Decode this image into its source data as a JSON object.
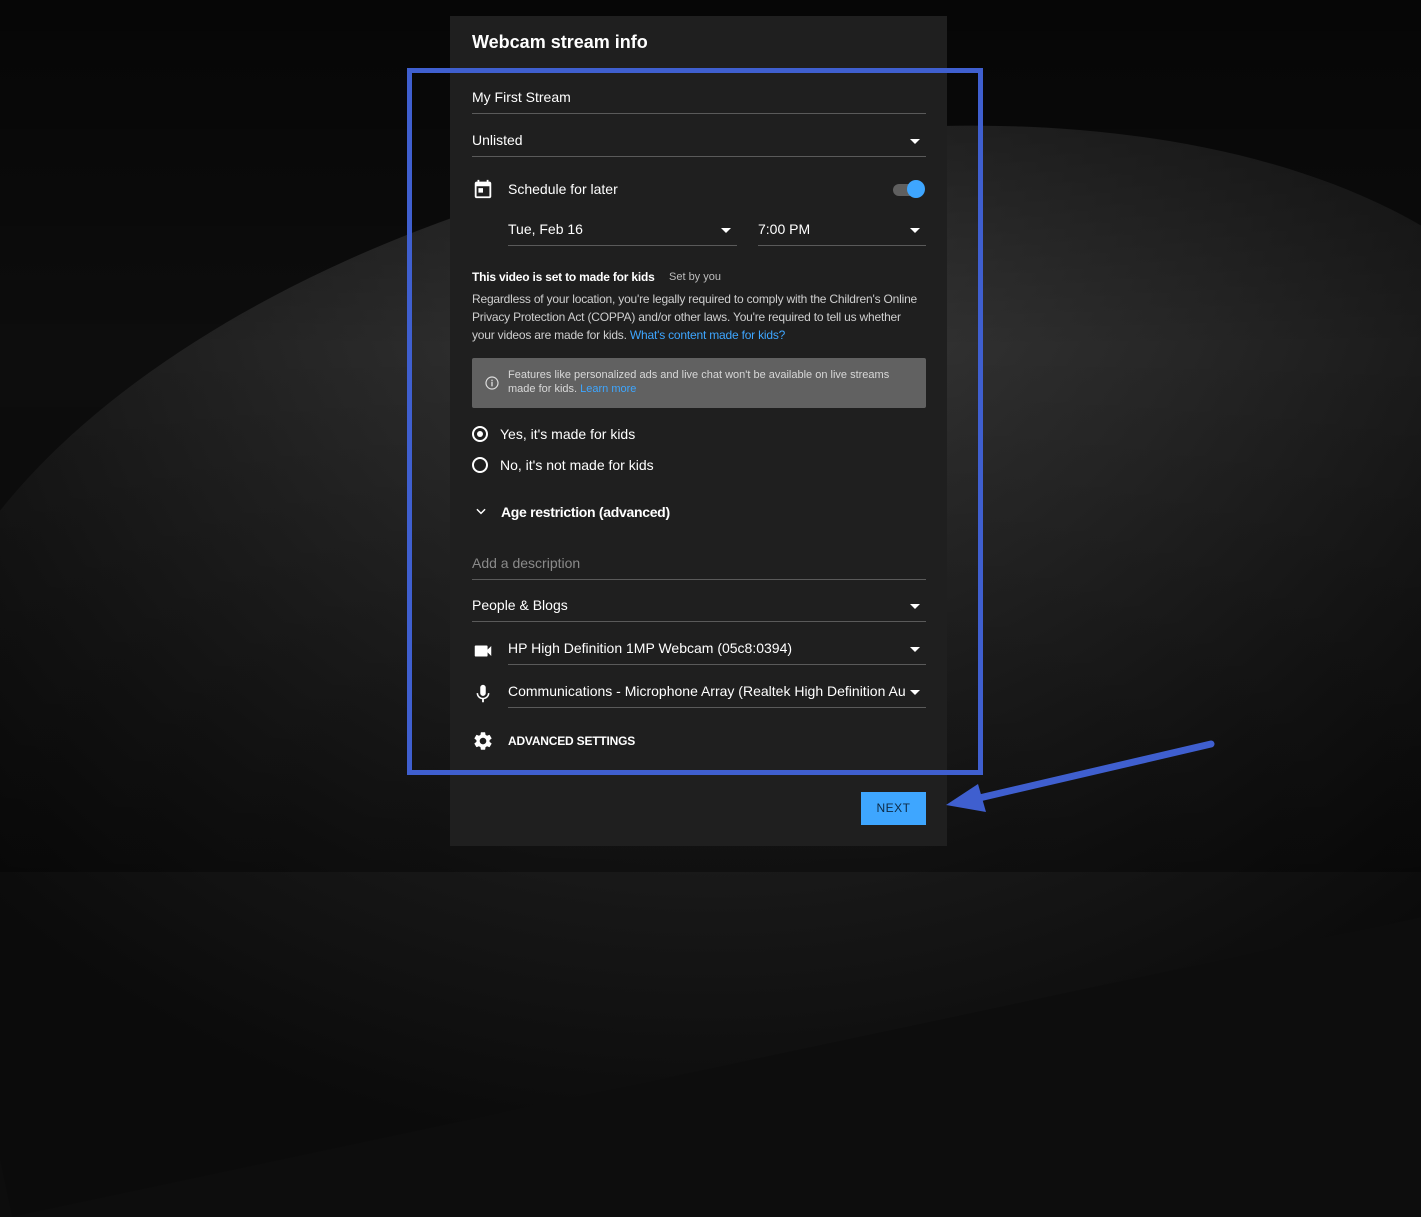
{
  "dialog": {
    "title": "Webcam stream info",
    "stream_title": "My First Stream",
    "visibility": "Unlisted",
    "schedule_label": "Schedule for later",
    "schedule_enabled": true,
    "date": "Tue, Feb 16",
    "time": "7:00 PM",
    "kids": {
      "heading": "This video is set to made for kids",
      "set_by": "Set by you",
      "body": "Regardless of your location, you're legally required to comply with the Children's Online Privacy Protection Act (COPPA) and/or other laws. You're required to tell us whether your videos are made for kids.",
      "body_link": "What's content made for kids?",
      "info_text": "Features like personalized ads and live chat won't be available on live streams made for kids.",
      "info_link": "Learn more",
      "option_yes": "Yes, it's made for kids",
      "option_no": "No, it's not made for kids",
      "selected": "yes"
    },
    "age_restriction_label": "Age restriction (advanced)",
    "description_placeholder": "Add a description",
    "category": "People & Blogs",
    "camera": "HP High Definition 1MP Webcam (05c8:0394)",
    "microphone": "Communications - Microphone Array (Realtek High Definition Audio)",
    "advanced_settings_label": "ADVANCED SETTINGS",
    "next_label": "NEXT"
  },
  "icons": {
    "calendar": "calendar-icon",
    "info": "info-icon",
    "chevron": "chevron-down-icon",
    "camera": "video-camera-icon",
    "mic": "microphone-icon",
    "gear": "gear-icon"
  },
  "colors": {
    "accent": "#3ea6ff",
    "dialog_bg": "#1f1f1f",
    "annotation": "#3f5fcf"
  }
}
